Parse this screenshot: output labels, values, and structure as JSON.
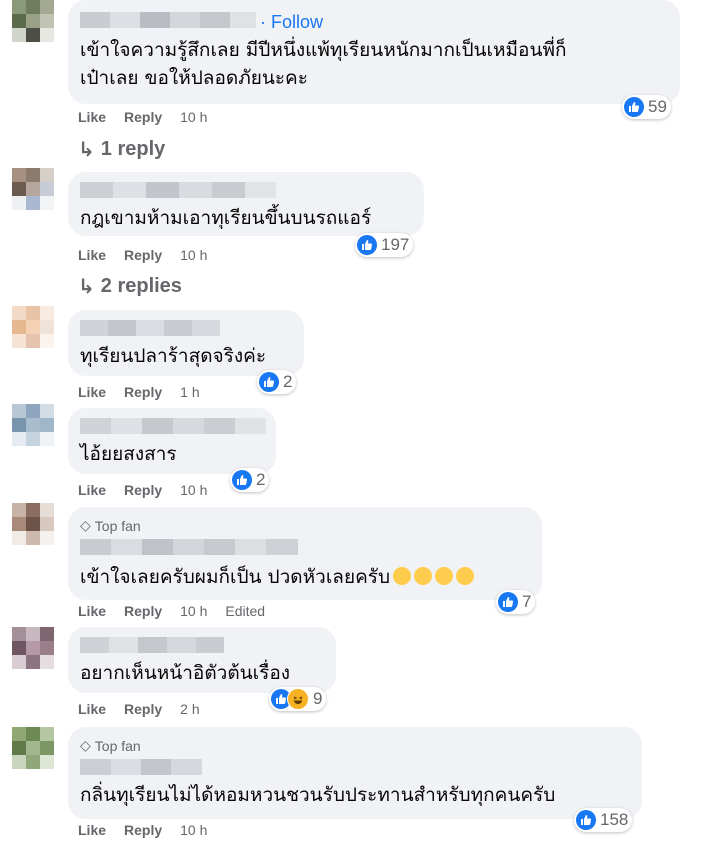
{
  "comments": [
    {
      "follow": "Follow",
      "text_lines": [
        "เข้าใจความรู้สึกเลย มีปีหนึ่งแพ้ทุเรียนหนักมากเป็นเหมือนพี่ก็",
        "เป๋าเลย ขอให้ปลอดภัยนะคะ"
      ],
      "like": "Like",
      "reply": "Reply",
      "time": "10 h",
      "reactions": "59",
      "replies": "1 reply"
    },
    {
      "text_lines": [
        "กฎเขามห้ามเอาทุเรียนขึ้นบนรถแอร์"
      ],
      "like": "Like",
      "reply": "Reply",
      "time": "10 h",
      "reactions": "197",
      "replies": "2 replies"
    },
    {
      "text_lines": [
        "ทุเรียนปลาร้าสุดจริงค่ะ"
      ],
      "like": "Like",
      "reply": "Reply",
      "time": "1 h",
      "reactions": "2"
    },
    {
      "text_lines": [
        "ไอ้ยยสงสาร"
      ],
      "like": "Like",
      "reply": "Reply",
      "time": "10 h",
      "reactions": "2"
    },
    {
      "badge": "Top fan",
      "text_lines": [
        "เข้าใจเลยครับผมก็เป็น ปวดหัวเลยครับ"
      ],
      "like": "Like",
      "reply": "Reply",
      "time": "10 h",
      "edited": "Edited",
      "reactions": "7"
    },
    {
      "text_lines": [
        "อยากเห็นหน้าอิตัวต้นเรื่อง"
      ],
      "like": "Like",
      "reply": "Reply",
      "time": "2 h",
      "reactions": "9"
    },
    {
      "badge": "Top fan",
      "text_lines": [
        "กลิ่นทุเรียนไม่ได้หอมหวนชวนรับประทานสำหรับทุกคนครับ"
      ],
      "like": "Like",
      "reply": "Reply",
      "time": "10 h",
      "reactions": "158"
    }
  ],
  "colors": {
    "accent": "#1877f2",
    "bubble": "#f0f2f5",
    "muted": "#65676b",
    "haha": "#f7b125"
  },
  "icons": {
    "like": "like-reaction-icon",
    "haha": "haha-reaction-icon",
    "reply_arrow": "reply-arrow-icon",
    "top_fan": "diamond-icon",
    "emoji": "grinning-sweat-emoji"
  }
}
